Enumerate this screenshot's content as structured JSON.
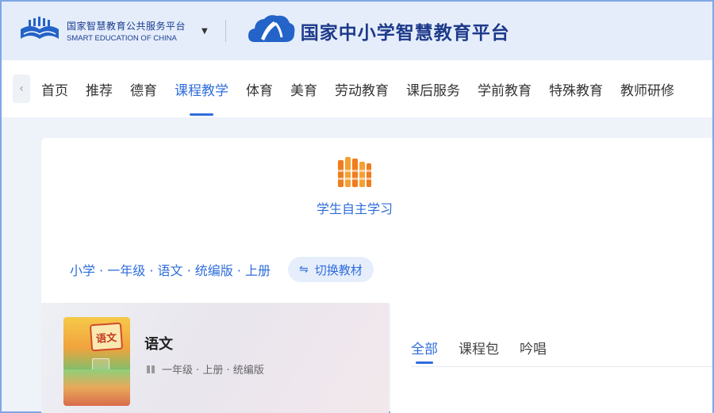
{
  "header": {
    "platform_cn": "国家智慧教育公共服务平台",
    "platform_en": "SMART EDUCATION OF CHINA",
    "brand_name": "国家中小学智慧教育平台"
  },
  "nav": {
    "items": [
      {
        "label": "首页"
      },
      {
        "label": "推荐"
      },
      {
        "label": "德育"
      },
      {
        "label": "课程教学",
        "active": true
      },
      {
        "label": "体育"
      },
      {
        "label": "美育"
      },
      {
        "label": "劳动教育"
      },
      {
        "label": "课后服务"
      },
      {
        "label": "学前教育"
      },
      {
        "label": "特殊教育"
      },
      {
        "label": "教师研修"
      }
    ]
  },
  "main": {
    "self_study_label": "学生自主学习",
    "textbook_path": "小学 · 一年级 · 语文 · 统编版 · 上册",
    "switch_label": "切换教材"
  },
  "book": {
    "cover_seal": "语文",
    "name": "语文",
    "meta": "一年级 · 上册 · 统编版"
  },
  "tabs": {
    "items": [
      {
        "label": "全部",
        "active": true
      },
      {
        "label": "课程包"
      },
      {
        "label": "吟唱"
      }
    ]
  },
  "colors": {
    "accent": "#2f6ddb",
    "brand_dark": "#1d3a8a",
    "header_bg": "#e5edfb",
    "self_study_icon": "#f07c1e"
  }
}
